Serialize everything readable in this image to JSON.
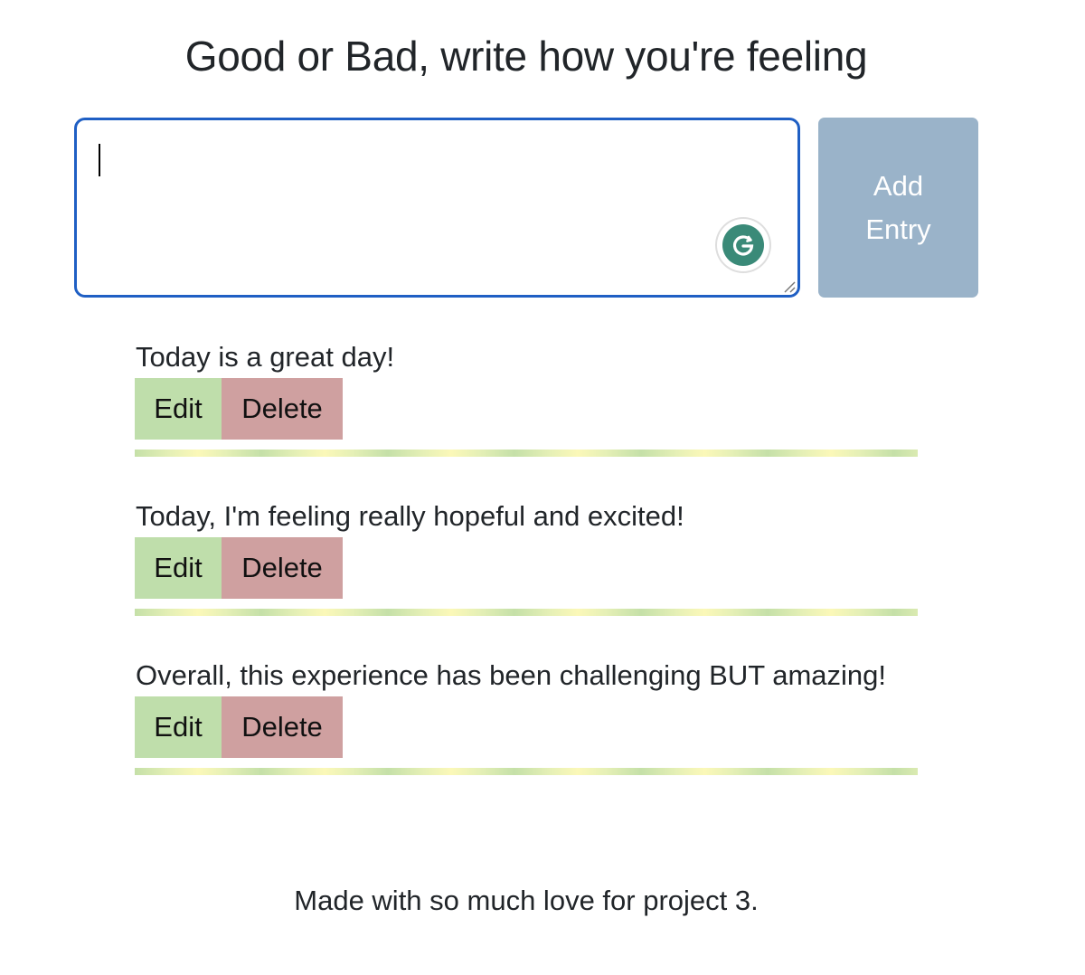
{
  "header": {
    "title": "Good or Bad, write how you're feeling"
  },
  "form": {
    "textarea_value": "",
    "add_button_label": "Add Entry",
    "grammarly_icon": "grammarly-g-icon"
  },
  "entries": [
    {
      "text": "Today is a great day!",
      "edit_label": "Edit",
      "delete_label": "Delete"
    },
    {
      "text": "Today, I'm feeling really hopeful and excited!",
      "edit_label": "Edit",
      "delete_label": "Delete"
    },
    {
      "text": "Overall, this experience has been challenging BUT amazing!",
      "edit_label": "Edit",
      "delete_label": "Delete"
    }
  ],
  "footer": {
    "text": "Made with so much love for project 3."
  },
  "colors": {
    "textarea_border": "#1f5fc4",
    "add_button_bg": "#9ab3c9",
    "edit_button_bg": "#bfdeab",
    "delete_button_bg": "#cfa0a0",
    "grammarly_green": "#3a8a78"
  }
}
